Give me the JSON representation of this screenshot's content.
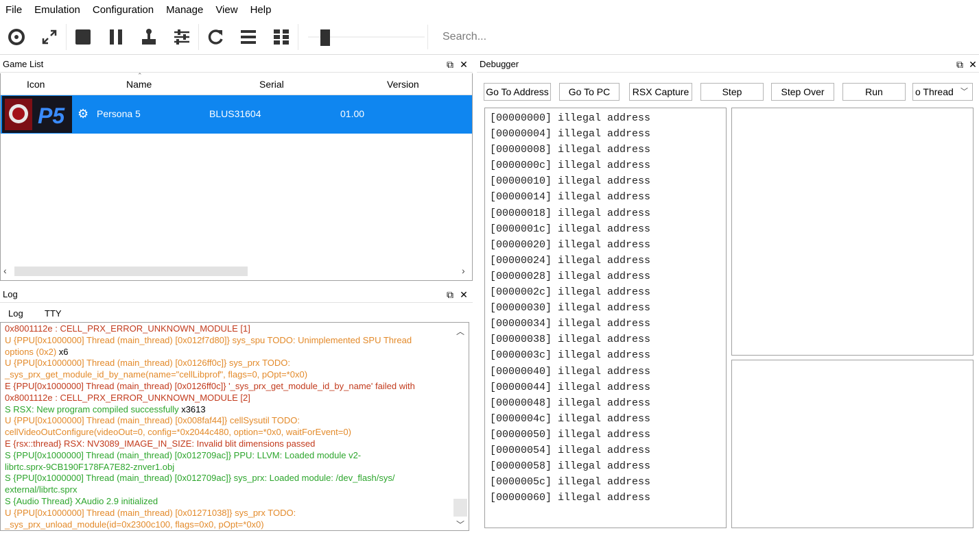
{
  "menu": [
    "File",
    "Emulation",
    "Configuration",
    "Manage",
    "View",
    "Help"
  ],
  "toolbar": {
    "icons": [
      "boot-disc-icon",
      "fullscreen-icon",
      "stop-icon",
      "pause-icon",
      "joystick-icon",
      "settings-sliders-icon",
      "refresh-icon",
      "list-view-icon",
      "grid-view-icon"
    ],
    "search_placeholder": "Search..."
  },
  "gamelist": {
    "title": "Game List",
    "columns": [
      "Icon",
      "Name",
      "Serial",
      "Version"
    ],
    "rows": [
      {
        "name": "Persona 5",
        "serial": "BLUS31604",
        "version": "01.00"
      }
    ]
  },
  "log": {
    "title": "Log",
    "tabs": [
      "Log",
      "TTY"
    ],
    "lines": [
      {
        "text": "0x8001112e : CELL_PRX_ERROR_UNKNOWN_MODULE [1]",
        "color": "red"
      },
      {
        "text": "U {PPU[0x1000000] Thread (main_thread) [0x012f7d80]} sys_spu TODO: Unimplemented SPU Thread",
        "color": "orange"
      },
      {
        "text": "options (0x2)",
        "color": "orange",
        "suffix": " x6"
      },
      {
        "text": "U {PPU[0x1000000] Thread (main_thread) [0x0126ff0c]} sys_prx TODO:",
        "color": "orange"
      },
      {
        "text": "_sys_prx_get_module_id_by_name(name=\"cellLibprof\", flags=0, pOpt=*0x0)",
        "color": "orange"
      },
      {
        "text": "E {PPU[0x1000000] Thread (main_thread) [0x0126ff0c]} '_sys_prx_get_module_id_by_name' failed with",
        "color": "red"
      },
      {
        "text": "0x8001112e : CELL_PRX_ERROR_UNKNOWN_MODULE [2]",
        "color": "red"
      },
      {
        "text": "S RSX: New program compiled successfully",
        "color": "green",
        "suffix": " x3613"
      },
      {
        "text": "U {PPU[0x1000000] Thread (main_thread) [0x008faf44]} cellSysutil TODO:",
        "color": "orange"
      },
      {
        "text": "cellVideoOutConfigure(videoOut=0, config=*0x2044c480, option=*0x0, waitForEvent=0)",
        "color": "orange"
      },
      {
        "text": "E {rsx::thread} RSX: NV3089_IMAGE_IN_SIZE: Invalid blit dimensions passed",
        "color": "red"
      },
      {
        "text": "S {PPU[0x1000000] Thread (main_thread) [0x012709ac]} PPU: LLVM: Loaded module v2-",
        "color": "green"
      },
      {
        "text": "librtc.sprx-9CB190F178FA7E82-znver1.obj",
        "color": "green"
      },
      {
        "text": "S {PPU[0x1000000] Thread (main_thread) [0x012709ac]} sys_prx: Loaded module: /dev_flash/sys/",
        "color": "green"
      },
      {
        "text": "external/librtc.sprx",
        "color": "green"
      },
      {
        "text": "S {Audio Thread} XAudio 2.9 initialized",
        "color": "green"
      },
      {
        "text": "U {PPU[0x1000000] Thread (main_thread) [0x01271038]} sys_prx TODO:",
        "color": "orange"
      },
      {
        "text": "_sys_prx_unload_module(id=0x2300c100, flags=0x0, pOpt=*0x0)",
        "color": "orange"
      }
    ]
  },
  "debugger": {
    "title": "Debugger",
    "buttons": [
      "Go To Address",
      "Go To PC",
      "RSX Capture",
      "Step",
      "Step Over",
      "Run"
    ],
    "thread_select": "o Thread",
    "memory_lines": [
      "[00000000] illegal address",
      "[00000004] illegal address",
      "[00000008] illegal address",
      "[0000000c] illegal address",
      "[00000010] illegal address",
      "[00000014] illegal address",
      "[00000018] illegal address",
      "[0000001c] illegal address",
      "[00000020] illegal address",
      "[00000024] illegal address",
      "[00000028] illegal address",
      "[0000002c] illegal address",
      "[00000030] illegal address",
      "[00000034] illegal address",
      "[00000038] illegal address",
      "[0000003c] illegal address",
      "[00000040] illegal address",
      "[00000044] illegal address",
      "[00000048] illegal address",
      "[0000004c] illegal address",
      "[00000050] illegal address",
      "[00000054] illegal address",
      "[00000058] illegal address",
      "[0000005c] illegal address",
      "[00000060] illegal address"
    ]
  },
  "colors": {
    "selection": "#0f86f0",
    "log_red": "#c23a1c",
    "log_orange": "#e38a2a",
    "log_green": "#2ca52c"
  }
}
